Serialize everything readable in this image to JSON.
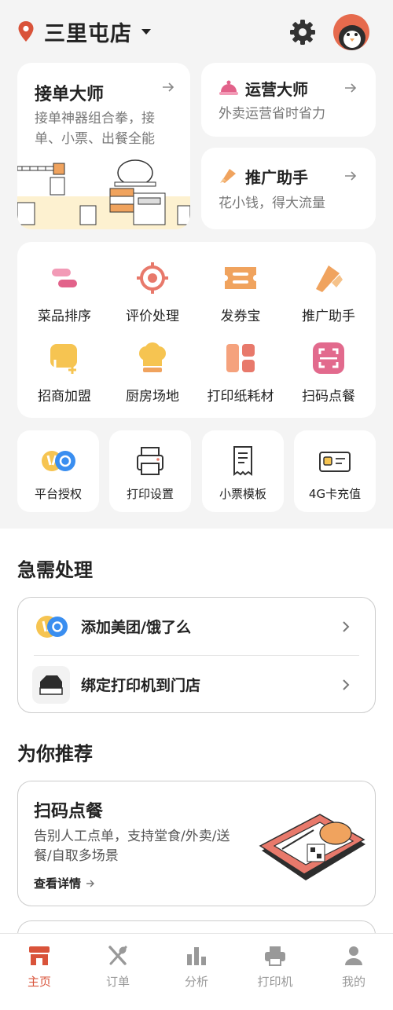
{
  "header": {
    "store_name": "三里屯店"
  },
  "hero_cards": {
    "master": {
      "title": "接单大师",
      "subtitle": "接单神器组合拳，接单、小票、出餐全能"
    },
    "operations": {
      "title": "运营大师",
      "subtitle": "外卖运营省时省力"
    },
    "promotion": {
      "title": "推广助手",
      "subtitle": "花小钱，得大流量"
    }
  },
  "grid": [
    {
      "label": "菜品排序",
      "icon": "sort-icon"
    },
    {
      "label": "评价处理",
      "icon": "target-icon"
    },
    {
      "label": "发券宝",
      "icon": "coupon-icon"
    },
    {
      "label": "推广助手",
      "icon": "megaphone-icon"
    },
    {
      "label": "招商加盟",
      "icon": "join-icon"
    },
    {
      "label": "厨房场地",
      "icon": "chef-hat-icon"
    },
    {
      "label": "打印纸耗材",
      "icon": "paper-roll-icon"
    },
    {
      "label": "扫码点餐",
      "icon": "scan-icon"
    }
  ],
  "mini_tools": [
    {
      "label": "平台授权",
      "icon": "platform-auth-icon"
    },
    {
      "label": "打印设置",
      "icon": "printer-icon"
    },
    {
      "label": "小票模板",
      "icon": "receipt-icon"
    },
    {
      "label": "4G卡充值",
      "icon": "sim-card-icon"
    }
  ],
  "urgent": {
    "title": "急需处理",
    "items": [
      {
        "label": "添加美团/饿了么",
        "icon": "meituan-eleme-icon"
      },
      {
        "label": "绑定打印机到门店",
        "icon": "printer-device-icon"
      }
    ]
  },
  "recommend": {
    "title": "为你推荐",
    "card": {
      "title": "扫码点餐",
      "desc": "告别人工点单，支持堂食/外卖/送餐/自取多场景",
      "link": "查看详情"
    }
  },
  "tabs": [
    {
      "label": "主页",
      "icon": "store-icon",
      "active": true
    },
    {
      "label": "订单",
      "icon": "cutlery-icon",
      "active": false
    },
    {
      "label": "分析",
      "icon": "bar-chart-icon",
      "active": false
    },
    {
      "label": "打印机",
      "icon": "printer-icon",
      "active": false
    },
    {
      "label": "我的",
      "icon": "user-icon",
      "active": false
    }
  ],
  "colors": {
    "accent": "#d9533a",
    "icon_orange": "#f0a35e",
    "icon_pink": "#e2628a",
    "background": "#f4f4f4"
  }
}
